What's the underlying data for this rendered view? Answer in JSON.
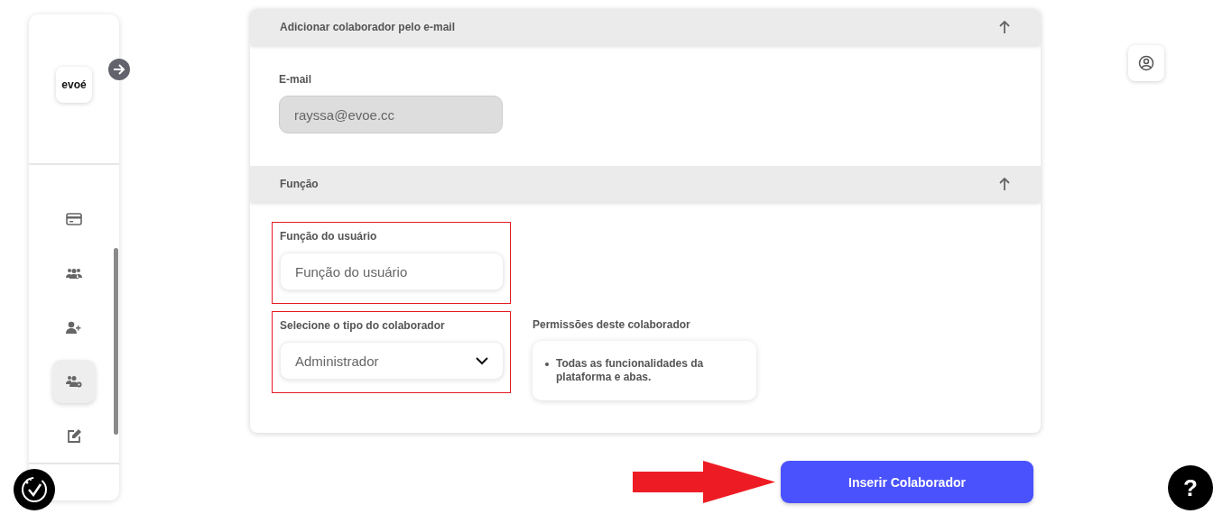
{
  "sidebar": {
    "logo": "evoé",
    "items": [
      {
        "kind": "card",
        "selected": false
      },
      {
        "kind": "group",
        "selected": false
      },
      {
        "kind": "user-add",
        "selected": false
      },
      {
        "kind": "group-settings",
        "selected": true
      },
      {
        "kind": "edit",
        "selected": false
      }
    ]
  },
  "sections": [
    {
      "title": "Adicionar colaborador pelo e-mail",
      "fields": [
        {
          "kind": "text",
          "label": "E-mail",
          "value": "rayssa@evoe.cc",
          "disabled": true
        }
      ]
    },
    {
      "title": "Função",
      "fields": [
        {
          "kind": "text",
          "label": "Função do usuário",
          "placeholder": "Função do usuário",
          "disabled": false,
          "highlighted": true
        },
        {
          "kind": "select",
          "label": "Selecione o tipo do colaborador",
          "value": "Administrador",
          "highlighted": true
        },
        {
          "kind": "list",
          "label": "Permissões deste colaborador",
          "items": [
            "Todas as funcionalidades da plataforma e abas."
          ]
        }
      ]
    }
  ],
  "submit": {
    "label": "Inserir Colaborador"
  },
  "help": {
    "label": "?"
  }
}
